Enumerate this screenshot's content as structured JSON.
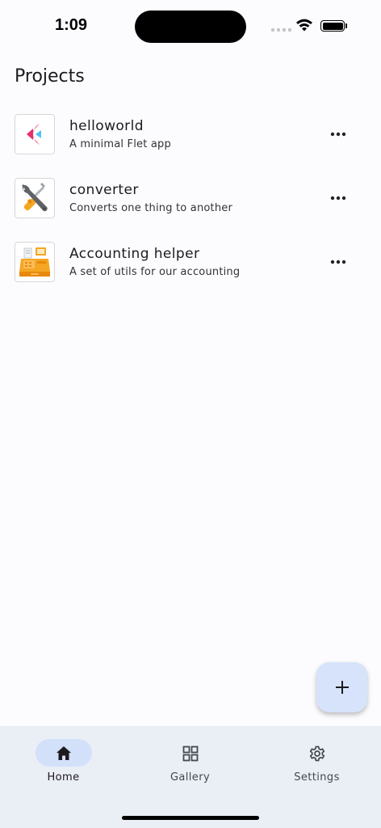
{
  "status_bar": {
    "time": "1:09"
  },
  "page": {
    "title": "Projects"
  },
  "projects": [
    {
      "name": "helloworld",
      "description": "A minimal Flet app",
      "icon": "flet-logo-icon"
    },
    {
      "name": "converter",
      "description": "Converts one thing to another",
      "icon": "wrench-screwdriver-icon"
    },
    {
      "name": "Accounting helper",
      "description": "A set of utils for our accounting",
      "icon": "cash-register-icon"
    }
  ],
  "fab": {
    "icon": "plus-icon"
  },
  "bottom_nav": {
    "items": [
      {
        "label": "Home",
        "icon": "home-icon",
        "active": true
      },
      {
        "label": "Gallery",
        "icon": "grid-icon",
        "active": false
      },
      {
        "label": "Settings",
        "icon": "gear-icon",
        "active": false
      }
    ]
  },
  "colors": {
    "background": "#fcfbfd",
    "fab": "#d6e3fb",
    "nav_background": "#eaeef5",
    "nav_indicator": "#d2e0fa",
    "flet_pink": "#e72f6a",
    "flet_cyan": "#4fc3f7"
  }
}
